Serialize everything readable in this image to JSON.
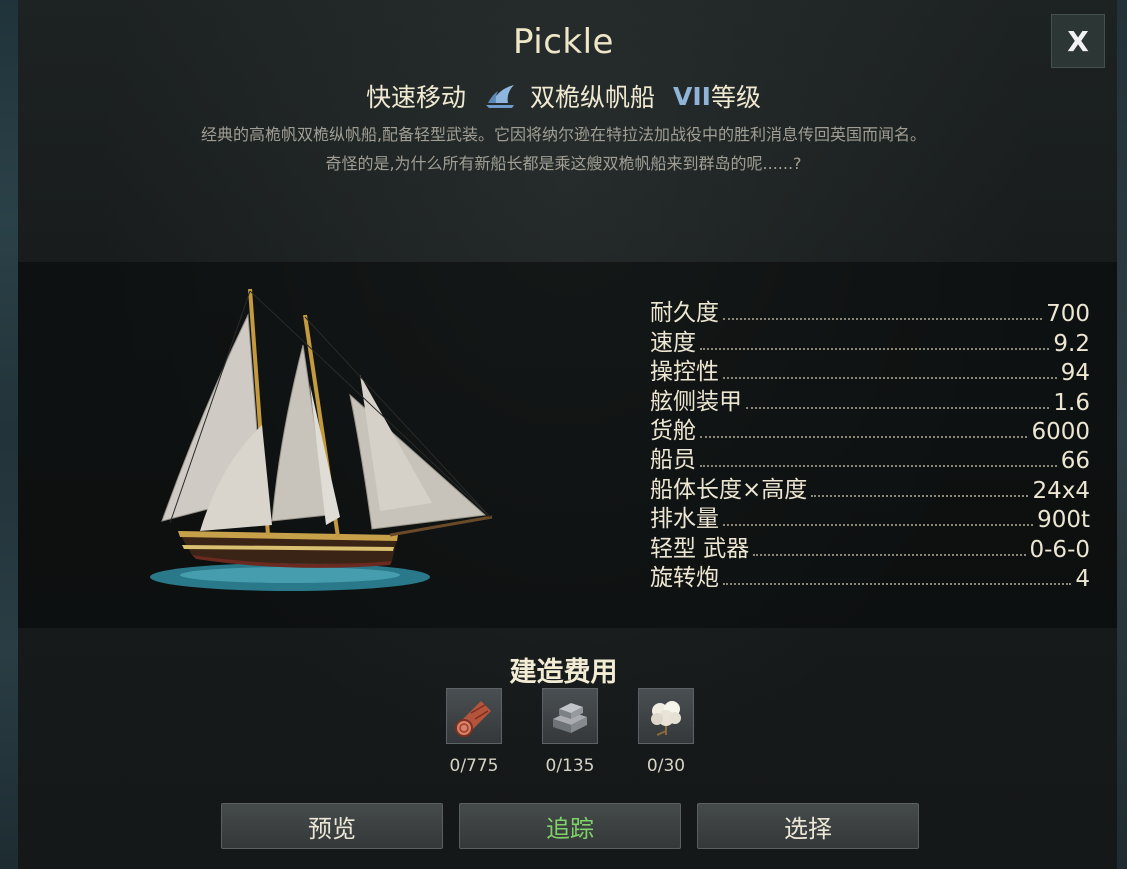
{
  "ship": {
    "name": "Pickle",
    "role": "快速移动",
    "class_icon": "sail-icon",
    "type": "双桅纵帆船",
    "tier_numeral": "VII",
    "tier_suffix": "等级",
    "description_line1": "经典的高桅帆双桅纵帆船,配备轻型武装。它因将纳尔逊在特拉法加战役中的胜利消息传回英国而闻名。",
    "description_line2": "奇怪的是,为什么所有新船长都是乘这艘双桅帆船来到群岛的呢......?"
  },
  "close_label": "X",
  "stats": [
    {
      "label": "耐久度",
      "value": "700"
    },
    {
      "label": "速度",
      "value": "9.2"
    },
    {
      "label": "操控性",
      "value": "94"
    },
    {
      "label": "舷侧装甲",
      "value": "1.6"
    },
    {
      "label": "货舱",
      "value": "6000"
    },
    {
      "label": "船员",
      "value": "66"
    },
    {
      "label": "船体长度×高度",
      "value": "24x4"
    },
    {
      "label": "排水量",
      "value": "900t"
    },
    {
      "label": "轻型 武器",
      "value": "0-6-0"
    },
    {
      "label": "旋转炮",
      "value": "4"
    }
  ],
  "build_cost": {
    "title": "建造费用",
    "resources": [
      {
        "icon": "wood-log-icon",
        "count": "0/775"
      },
      {
        "icon": "iron-ingot-icon",
        "count": "0/135"
      },
      {
        "icon": "cotton-icon",
        "count": "0/30"
      }
    ]
  },
  "buttons": {
    "preview": "预览",
    "track": "追踪",
    "select": "选择"
  },
  "colors": {
    "track_green": "#7fd267",
    "tier_blue": "#8fb4d8",
    "panel_bg": "#181c1c"
  }
}
